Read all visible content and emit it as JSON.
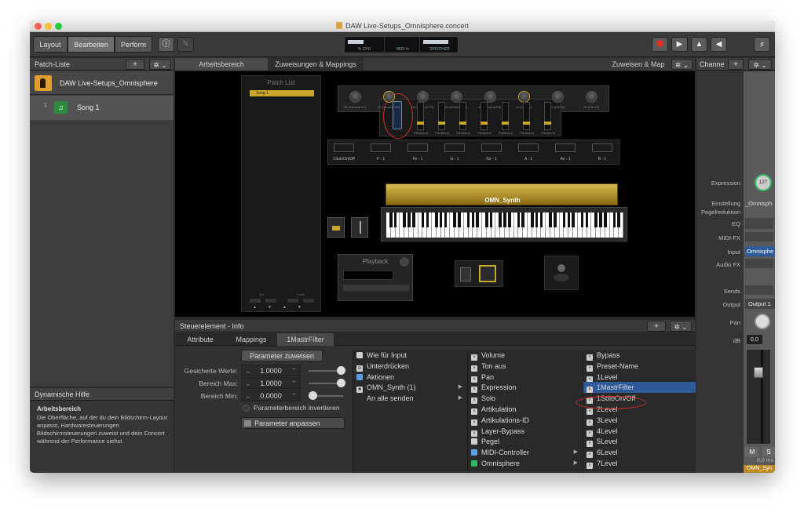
{
  "window": {
    "title": "DAW Live-Setups_Omnisphere.concert"
  },
  "toolbar": {
    "layout_label": "Layout",
    "edit_label": "Bearbeiten",
    "perform_label": "Perform",
    "lcd": {
      "cpu_label": "% CPU",
      "midi_label": "MIDI In",
      "memory_label": "SPEICHER"
    }
  },
  "patch_list": {
    "title": "Patch-Liste",
    "concert_name": "DAW Live-Setups_Omnisphere",
    "songs": [
      {
        "number": "1",
        "name": "Song 1"
      }
    ]
  },
  "dynamic_help": {
    "title": "Dynamische Hilfe",
    "heading": "Arbeitsbereich",
    "body": "Die Oberfläche, auf der du dein Bildschirm-Layout anpasst, Hardwaresteuerungen Bildschirmsteuerungen zuweist und dein Concert während der Performance siehst."
  },
  "workspace": {
    "tabs": [
      "Arbeitsbereich",
      "Zuweisungen & Mappings"
    ],
    "assign_button": "Zuweisen & Map",
    "patch_list_widget": {
      "title": "Patch List",
      "item": "Song 1",
      "set_label": "Set",
      "patch_label": "Patch"
    },
    "knob_labels": [
      "16 (General P1)",
      "17 (General P2)",
      "18 (General P3)",
      "19 (General P4)",
      "80 (General P5)",
      "21 (Ctrl 21)",
      "22 (Ctrl 22)",
      "23 (Ctrl 23)"
    ],
    "pitchbend_label": "Pitchbend",
    "pad_labels": [
      "1SoloOn/Off",
      "F - 1",
      "F♯ - 1",
      "G - 1",
      "G♯ - 1",
      "A - 1",
      "A♯ - 1",
      "B - 1"
    ],
    "keyboard_name": "OMN_Synth",
    "playback_label": "Playback"
  },
  "info": {
    "title": "Steuerelement - Info",
    "tabs": [
      "Attribute",
      "Mappings",
      "1MastrFilter"
    ],
    "assign_param_button": "Parameter zuweisen",
    "saved_values_label": "Gesicherte Werte:",
    "saved_values_value": "1.0000",
    "range_max_label": "Bereich Max:",
    "range_max_value": "1.0000",
    "range_min_label": "Bereich Min:",
    "range_min_value": "0.0000",
    "invert_label": "Parameterbereich invertieren",
    "adjust_button": "Parameter anpassen",
    "col1": [
      "Wie für Input",
      "Unterdrücken",
      "Aktionen",
      "OMN_Synth (1)",
      "An alle senden"
    ],
    "col2": [
      "Volume",
      "Ton aus",
      "Pan",
      "Expression",
      "Solo",
      "Artikulation",
      "Artikulations-ID",
      "Layer-Bypass",
      "Pegel",
      "MIDI-Controller",
      "Omnisphere"
    ],
    "col3": [
      "Bypass",
      "Preset-Name",
      "1Level",
      "1MastrFilter",
      "1SoloOn/Off",
      "2Level",
      "3Level",
      "4Level",
      "5Level",
      "6Level",
      "7Level"
    ]
  },
  "channel": {
    "title": "Channe",
    "expression_label": "Expression",
    "expression_value": "127",
    "setting_label": "Einstellung",
    "setting_value": "_Omnisph",
    "level_reduction_label": "Pegelreduktion",
    "eq_label": "EQ",
    "midifx_label": "MIDI-FX",
    "input_label": "Input",
    "input_value": "Omnisphe",
    "audiofx_label": "Audio FX",
    "sends_label": "Sends",
    "output_label": "Output",
    "output_value": "Output 1",
    "pan_label": "Pan",
    "db_label": "dB",
    "db_value": "0,0",
    "m_label": "M",
    "s_label": "S",
    "ms_value": "0,0 ms",
    "channel_name": "OMN_Syn"
  }
}
